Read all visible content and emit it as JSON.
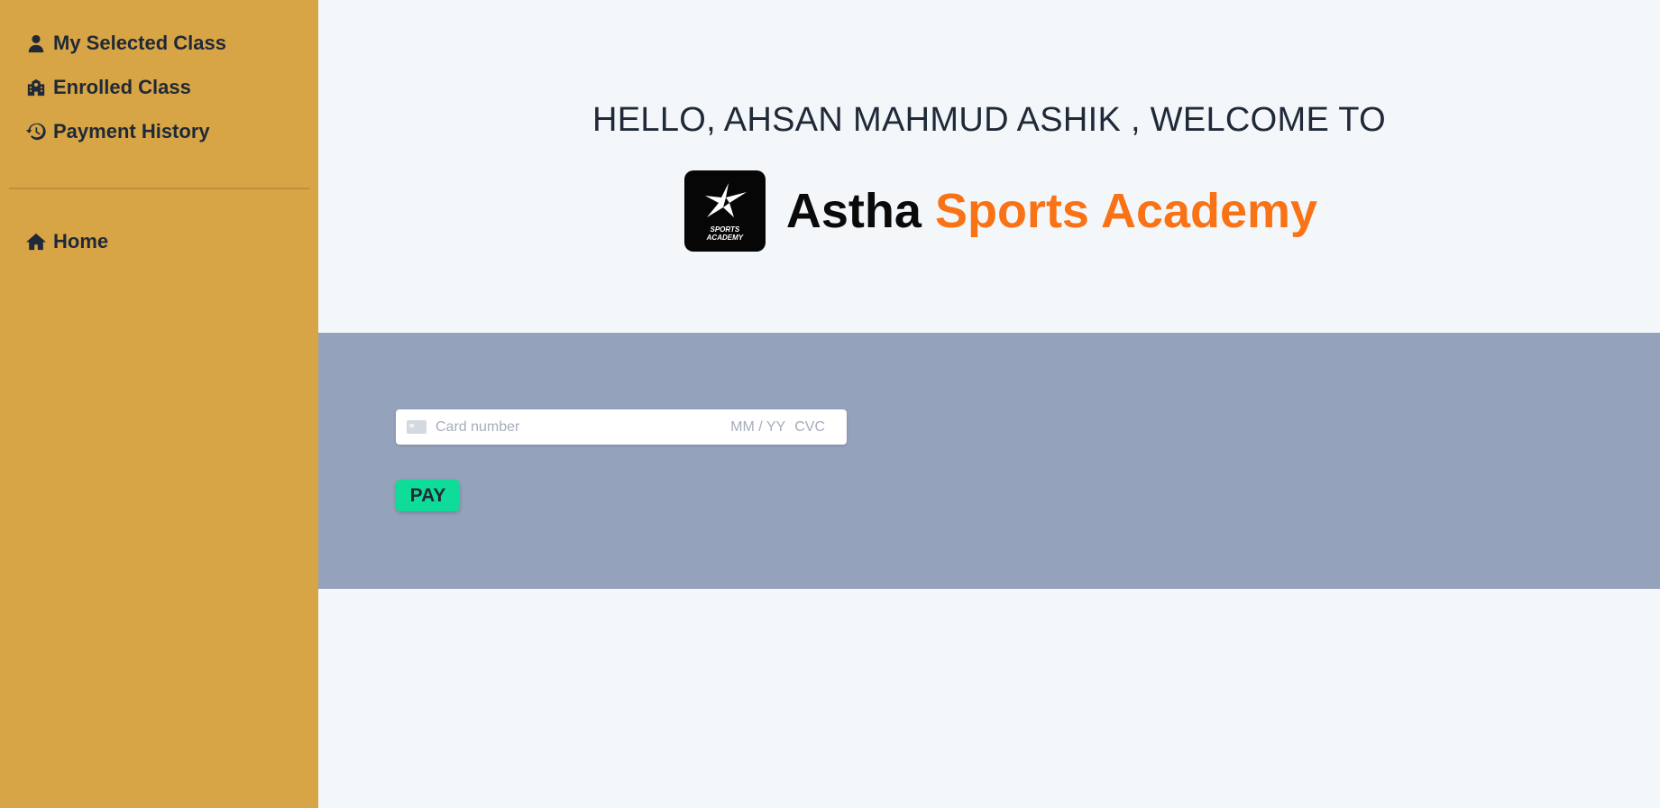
{
  "sidebar": {
    "items": [
      {
        "label": "My Selected Class",
        "icon": "user-icon"
      },
      {
        "label": "Enrolled Class",
        "icon": "school-icon"
      },
      {
        "label": "Payment History",
        "icon": "history-icon"
      }
    ],
    "secondary": [
      {
        "label": "Home",
        "icon": "home-icon"
      }
    ]
  },
  "main": {
    "welcome": "HELLO, AHSAN MAHMUD ASHIK , WELCOME TO",
    "brand": {
      "name_primary": "Astha",
      "name_accent": "Sports Academy",
      "logo_line1": "SPORTS",
      "logo_line2": "ACADEMY"
    },
    "payment": {
      "card_placeholder": "Card number",
      "expiry_placeholder": "MM / YY",
      "cvc_placeholder": "CVC",
      "pay_label": "PAY"
    }
  },
  "colors": {
    "sidebar_bg": "#d7a446",
    "accent": "#f97316",
    "pay_section_bg": "#94a2bb",
    "pay_button": "#0fdc98"
  }
}
